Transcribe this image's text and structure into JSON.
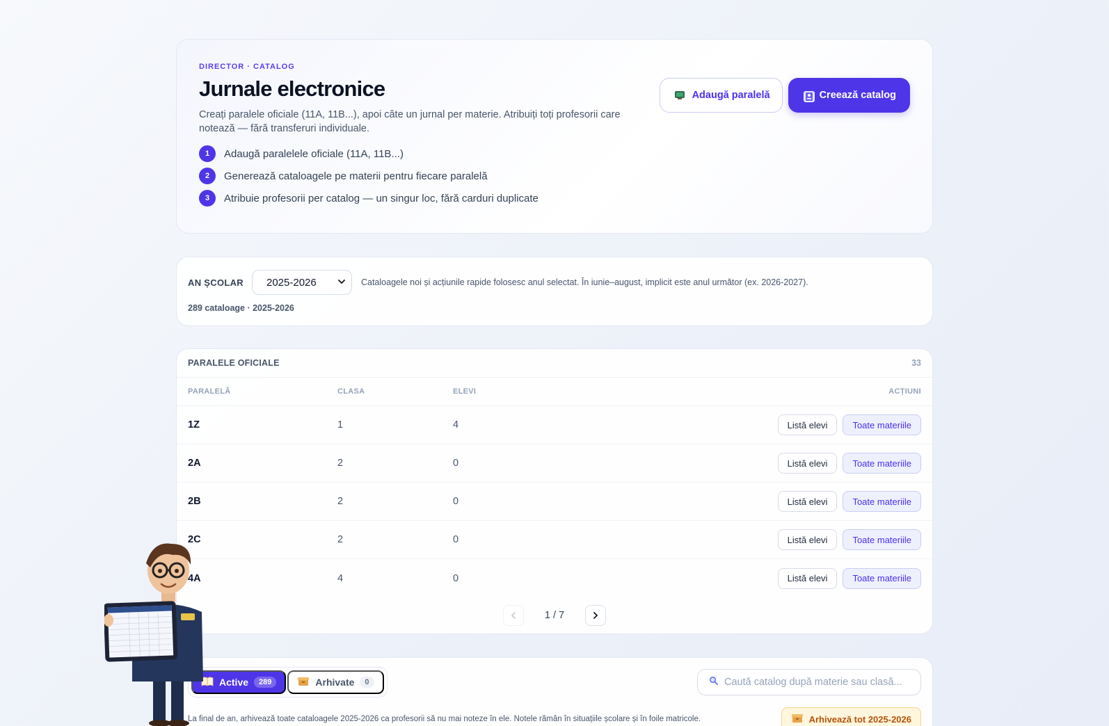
{
  "hero": {
    "eyebrow": "DIRECTOR · CATALOG",
    "title": "Jurnale electronice",
    "description": "Creați paralele oficiale (11A, 11B...), apoi câte un jurnal per materie. Atribuiți toți profesorii care notează — fără transferuri individuale.",
    "steps": [
      {
        "num": "1",
        "text": "Adaugă paralelele oficiale (11A, 11B...)"
      },
      {
        "num": "2",
        "text": "Generează cataloagele pe materii pentru fiecare paralelă"
      },
      {
        "num": "3",
        "text": "Atribuie profesorii per catalog — un singur loc, fără carduri duplicate"
      }
    ],
    "add_parallel_label": "Adaugă paralelă",
    "create_catalog_label": "Creează catalog"
  },
  "year": {
    "label": "AN ȘCOLAR",
    "selected": "2025-2026",
    "note": "Cataloagele noi și acțiunile rapide folosesc anul selectat. În iunie–august, implicit este anul următor (ex. 2026-2027).",
    "count": "289 cataloage · 2025-2026"
  },
  "parallels": {
    "title": "PARALELE OFICIALE",
    "count": "33",
    "columns": {
      "name": "PARALELĂ",
      "class": "CLASA",
      "students": "ELEVI",
      "actions": "ACȚIUNI"
    },
    "rows": [
      {
        "name": "1Z",
        "class": "1",
        "students": "4",
        "list_label": "Listă elevi",
        "subjects_label": "Toate materiile"
      },
      {
        "name": "2A",
        "class": "2",
        "students": "0",
        "list_label": "Listă elevi",
        "subjects_label": "Toate materiile"
      },
      {
        "name": "2B",
        "class": "2",
        "students": "0",
        "list_label": "Listă elevi",
        "subjects_label": "Toate materiile"
      },
      {
        "name": "2C",
        "class": "2",
        "students": "0",
        "list_label": "Listă elevi",
        "subjects_label": "Toate materiile"
      },
      {
        "name": "4A",
        "class": "4",
        "students": "0",
        "list_label": "Listă elevi",
        "subjects_label": "Toate materiile"
      }
    ],
    "pager": {
      "text": "1 / 7",
      "prev": "‹",
      "next": "›"
    }
  },
  "catalogs": {
    "tabs": [
      {
        "label": "Active",
        "count": "289"
      },
      {
        "label": "Arhivate",
        "count": "0"
      }
    ],
    "search_placeholder": "Caută catalog după materie sau clasă...",
    "note": "La final de an, arhivează toate cataloagele 2025-2026 ca profesorii să nu mai noteze în ele. Notele rămân în situațiile școlare și în foile matricole.",
    "archive_label": "Arhivează tot 2025-2026"
  },
  "colors": {
    "accent": "#4f35e8",
    "archive": "#b45309"
  }
}
